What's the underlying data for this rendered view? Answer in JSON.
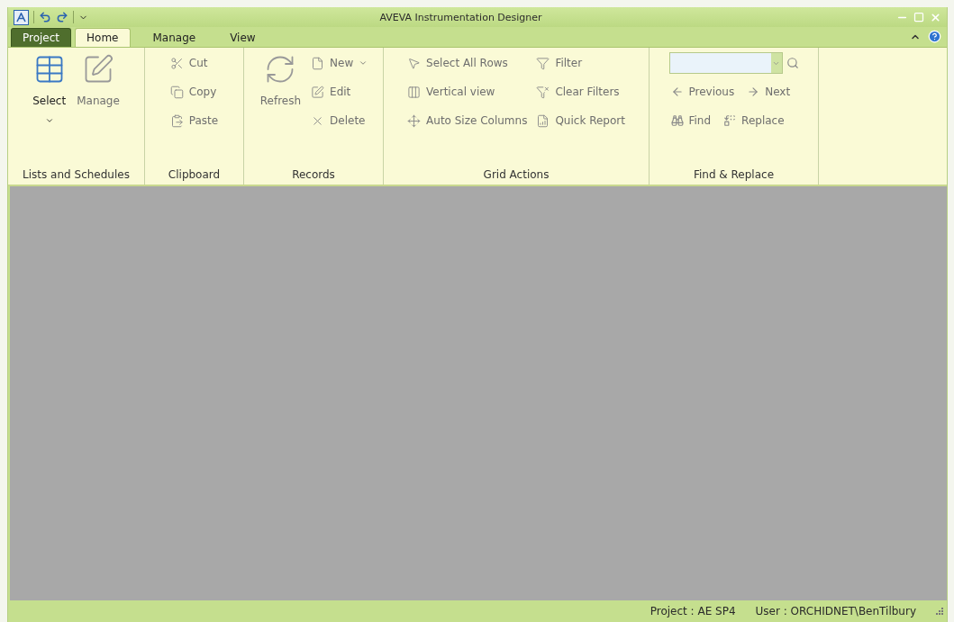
{
  "window": {
    "title": "AVEVA Instrumentation Designer"
  },
  "tabs": [
    {
      "label": "Project",
      "kind": "app",
      "selected": false
    },
    {
      "label": "Home",
      "kind": "tab",
      "selected": true
    },
    {
      "label": "Manage",
      "kind": "tab",
      "selected": false
    },
    {
      "label": "View",
      "kind": "tab",
      "selected": false
    }
  ],
  "ribbon_groups": [
    {
      "label": "Lists and Schedules",
      "kind": "columns",
      "columns": [
        [
          {
            "label": "Select",
            "kind": "large",
            "dropdown": true,
            "disabled": false
          }
        ],
        [
          {
            "label": "Manage",
            "kind": "large",
            "dropdown": false,
            "disabled": true
          }
        ]
      ]
    },
    {
      "label": "Clipboard",
      "kind": "columns",
      "columns": [
        [
          {
            "label": "Cut",
            "kind": "small",
            "dropdown": false,
            "disabled": true
          },
          {
            "label": "Copy",
            "kind": "small",
            "dropdown": false,
            "disabled": true
          },
          {
            "label": "Paste",
            "kind": "small",
            "dropdown": false,
            "disabled": true
          }
        ]
      ]
    },
    {
      "label": "Records",
      "kind": "columns",
      "columns": [
        [
          {
            "label": "Refresh",
            "kind": "large",
            "dropdown": false,
            "disabled": true
          }
        ],
        [
          {
            "label": "New",
            "kind": "small",
            "dropdown": true,
            "disabled": true
          },
          {
            "label": "Edit",
            "kind": "small",
            "dropdown": false,
            "disabled": true
          },
          {
            "label": "Delete",
            "kind": "small",
            "dropdown": false,
            "disabled": true
          }
        ]
      ]
    },
    {
      "label": "Grid Actions",
      "kind": "columns",
      "columns": [
        [
          {
            "label": "Select All Rows",
            "kind": "small",
            "dropdown": false,
            "disabled": true
          },
          {
            "label": "Vertical view",
            "kind": "small",
            "dropdown": false,
            "disabled": true
          },
          {
            "label": "Auto Size Columns",
            "kind": "small",
            "dropdown": false,
            "disabled": true
          }
        ],
        [
          {
            "label": "Filter",
            "kind": "small",
            "dropdown": false,
            "disabled": true
          },
          {
            "label": "Clear Filters",
            "kind": "small",
            "dropdown": false,
            "disabled": true
          },
          {
            "label": "Quick Report",
            "kind": "small",
            "dropdown": false,
            "disabled": true
          }
        ]
      ]
    },
    {
      "label": "Find & Replace",
      "kind": "find",
      "rows": [
        [
          {
            "label": "Previous",
            "disabled": true
          },
          {
            "label": "Next",
            "disabled": true
          }
        ],
        [
          {
            "label": "Find",
            "disabled": true
          },
          {
            "label": "Replace",
            "disabled": true
          }
        ]
      ]
    }
  ],
  "status_bar": [
    "Project : AE SP4",
    "User : ORCHIDNET\\BenTilbury"
  ]
}
